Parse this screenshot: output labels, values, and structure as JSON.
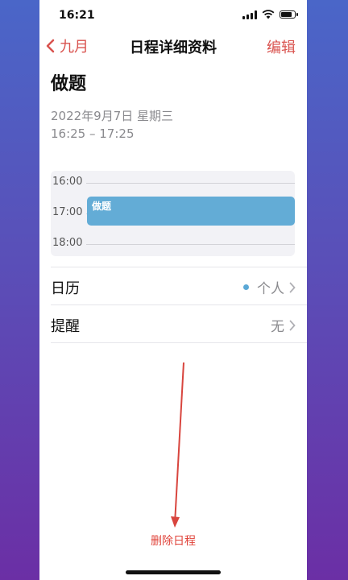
{
  "status_bar": {
    "time": "16:21"
  },
  "nav": {
    "back_label": "九月",
    "title": "日程详细资料",
    "edit_label": "编辑"
  },
  "event": {
    "title": "做题",
    "date": "2022年9月7日 星期三",
    "time_range": "16:25 – 17:25"
  },
  "timeline": {
    "hours": [
      "16:00",
      "17:00",
      "18:00"
    ],
    "event_label": "做题",
    "event_color": "#63acd6"
  },
  "details": {
    "calendar_label": "日历",
    "calendar_value": "个人",
    "calendar_color": "#5aa8d6",
    "alert_label": "提醒",
    "alert_value": "无"
  },
  "footer": {
    "delete_label": "删除日程"
  },
  "colors": {
    "accent": "#d9534f",
    "delete": "#e0433a"
  },
  "icons": [
    "chevron-left-icon",
    "signal-icon",
    "wifi-icon",
    "battery-icon",
    "chevron-right-icon",
    "arrow-down-icon"
  ]
}
